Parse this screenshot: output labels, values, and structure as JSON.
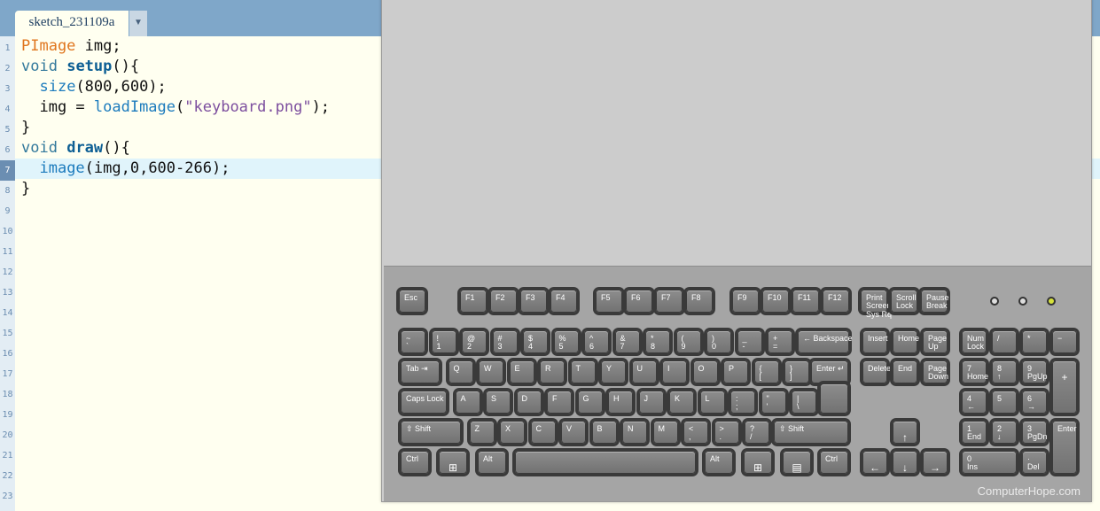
{
  "tab": {
    "name": "sketch_231109a",
    "menu_icon": "triangle-down-icon"
  },
  "line_numbers": [
    "1",
    "2",
    "3",
    "4",
    "5",
    "6",
    "7",
    "8",
    "9",
    "10",
    "11",
    "12",
    "13",
    "14",
    "15",
    "16",
    "17",
    "18",
    "19",
    "20",
    "21",
    "22",
    "23"
  ],
  "active_line": "7",
  "code": {
    "l1": {
      "type": "PImage",
      "rest": " img;"
    },
    "l2": {
      "kw": "void",
      "name": "setup",
      "rest": "(){"
    },
    "l3": {
      "fn": "size",
      "rest": "(800,600);"
    },
    "l4": {
      "pre": "  img = ",
      "fn": "loadImage",
      "open": "(",
      "str": "\"keyboard.png\"",
      "close": ");"
    },
    "l5": "}",
    "l6": {
      "kw": "void",
      "name": "draw",
      "rest": "(){"
    },
    "l7": {
      "fn": "image",
      "rest": "(img,0,600-266);"
    },
    "l8": "}"
  },
  "keyboard": {
    "watermark": "ComputerHope.com",
    "row_fn": [
      "Esc",
      "F1",
      "F2",
      "F3",
      "F4",
      "F5",
      "F6",
      "F7",
      "F8",
      "F9",
      "F10",
      "F11",
      "F12",
      "Print\nScreen\nSys Rq",
      "Scroll\nLock",
      "Pause\nBreak"
    ],
    "row_num": [
      [
        "~",
        "`"
      ],
      [
        "!",
        "1"
      ],
      [
        "@",
        "2"
      ],
      [
        "#",
        "3"
      ],
      [
        "$",
        "4"
      ],
      [
        "%",
        "5"
      ],
      [
        "^",
        "6"
      ],
      [
        "&",
        "7"
      ],
      [
        "*",
        "8"
      ],
      [
        "(",
        "9"
      ],
      [
        ")",
        "0"
      ],
      [
        "_",
        "-"
      ],
      [
        "+",
        "="
      ],
      [
        "",
        "← Backspace"
      ]
    ],
    "row_q": [
      "Tab ⇥",
      "Q",
      "W",
      "E",
      "R",
      "T",
      "Y",
      "U",
      "I",
      "O",
      "P",
      [
        "{",
        "["
      ],
      [
        "}",
        "]"
      ],
      "Enter ↵"
    ],
    "row_a": [
      "Caps Lock",
      "A",
      "S",
      "D",
      "F",
      "G",
      "H",
      "J",
      "K",
      "L",
      [
        ":",
        ";"
      ],
      [
        "\"",
        "'"
      ],
      [
        "|",
        "\\"
      ]
    ],
    "row_z": [
      "⇧ Shift",
      "Z",
      "X",
      "C",
      "V",
      "B",
      "N",
      "M",
      [
        "<",
        ","
      ],
      [
        ">",
        "."
      ],
      [
        "?",
        "/"
      ],
      "⇧ Shift"
    ],
    "row_b": [
      "Ctrl",
      "⊞",
      "Alt",
      "",
      "Alt",
      "⊞",
      "▤",
      "Ctrl"
    ],
    "nav_top": [
      "Insert",
      "Home",
      "Page\nUp"
    ],
    "nav_bot": [
      "Delete",
      "End",
      "Page\nDown"
    ],
    "arrows": [
      "↑",
      "←",
      "↓",
      "→"
    ],
    "numpad": [
      "Num\nLock",
      "/",
      "*",
      "−",
      "7\nHome",
      "8\n↑",
      "9\nPgUp",
      "+",
      "4\n←",
      "5",
      "6\n→",
      "1\nEnd",
      "2\n↓",
      "3\nPgDn",
      "Enter",
      "0\nIns",
      "·\nDel"
    ]
  }
}
